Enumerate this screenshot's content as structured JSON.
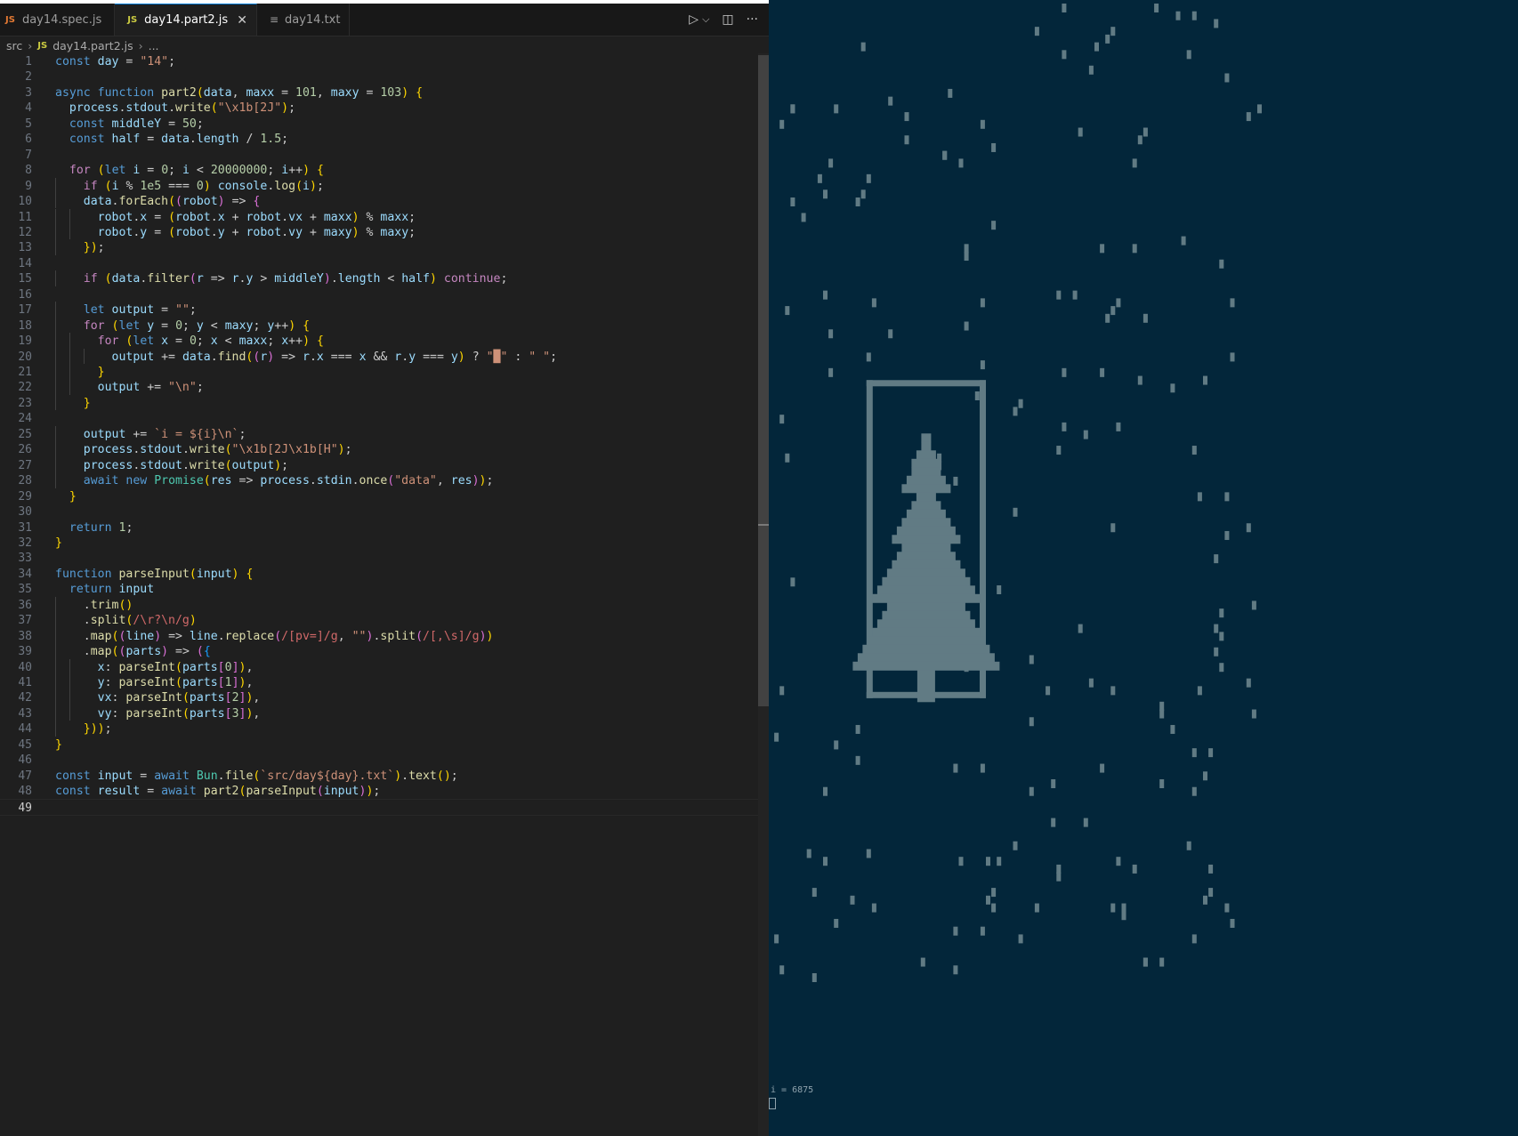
{
  "tabs": [
    {
      "label": "day14.spec.js",
      "icon": "js-icon",
      "active": false
    },
    {
      "label": "day14.part2.js",
      "icon": "js-icon",
      "active": true
    },
    {
      "label": "day14.txt",
      "icon": "text-file-icon",
      "active": false
    }
  ],
  "tab_actions": {
    "run": "▷",
    "run_menu": "⌵",
    "split": "◫",
    "more": "···"
  },
  "breadcrumb": {
    "folder": "src",
    "file": "day14.part2.js",
    "more": "..."
  },
  "editor": {
    "line_numbers": [
      "1",
      "2",
      "3",
      "4",
      "5",
      "6",
      "7",
      "8",
      "9",
      "10",
      "11",
      "12",
      "13",
      "14",
      "15",
      "16",
      "17",
      "18",
      "19",
      "20",
      "21",
      "22",
      "23",
      "24",
      "25",
      "26",
      "27",
      "28",
      "29",
      "30",
      "31",
      "32",
      "33",
      "34",
      "35",
      "36",
      "37",
      "38",
      "39",
      "40",
      "41",
      "42",
      "43",
      "44",
      "45",
      "46",
      "47",
      "48",
      "49"
    ],
    "current_line": "49",
    "lines": [
      "const day = \"14\";",
      "",
      "async function part2(data, maxx = 101, maxy = 103) {",
      "  process.stdout.write(\"\\x1b[2J\");",
      "  const middleY = 50;",
      "  const half = data.length / 1.5;",
      "",
      "  for (let i = 0; i < 20000000; i++) {",
      "    if (i % 1e5 === 0) console.log(i);",
      "    data.forEach((robot) => {",
      "      robot.x = (robot.x + robot.vx + maxx) % maxx;",
      "      robot.y = (robot.y + robot.vy + maxy) % maxy;",
      "    });",
      "",
      "    if (data.filter(r => r.y > middleY).length < half) continue;",
      "",
      "    let output = \"\";",
      "    for (let y = 0; y < maxy; y++) {",
      "      for (let x = 0; x < maxx; x++) {",
      "        output += data.find((r) => r.x === x && r.y === y) ? \"█\" : \" \";",
      "      }",
      "      output += \"\\n\";",
      "    }",
      "",
      "    output += `i = ${i}\\n`;",
      "    process.stdout.write(\"\\x1b[2J\\x1b[H\");",
      "    process.stdout.write(output);",
      "    await new Promise(res => process.stdin.once(\"data\", res));",
      "  }",
      "",
      "  return 1;",
      "}",
      "",
      "function parseInput(input) {",
      "  return input",
      "    .trim()",
      "    .split(/\\r?\\n/g)",
      "    .map((line) => line.replace(/[pv=]/g, \"\").split(/[,\\s]/g))",
      "    .map((parts) => ({",
      "      x: parseInt(parts[0]),",
      "      y: parseInt(parts[1]),",
      "      vx: parseInt(parts[2]),",
      "      vy: parseInt(parts[3]),",
      "    }));",
      "}",
      "",
      "const input = await Bun.file(`src/day${day}.txt`).text();",
      "const result = await part2(parseInput(input));",
      ""
    ]
  },
  "terminal": {
    "output": "i = 6875",
    "colors": {
      "background": "#03263a",
      "foreground": "#617b84"
    }
  }
}
